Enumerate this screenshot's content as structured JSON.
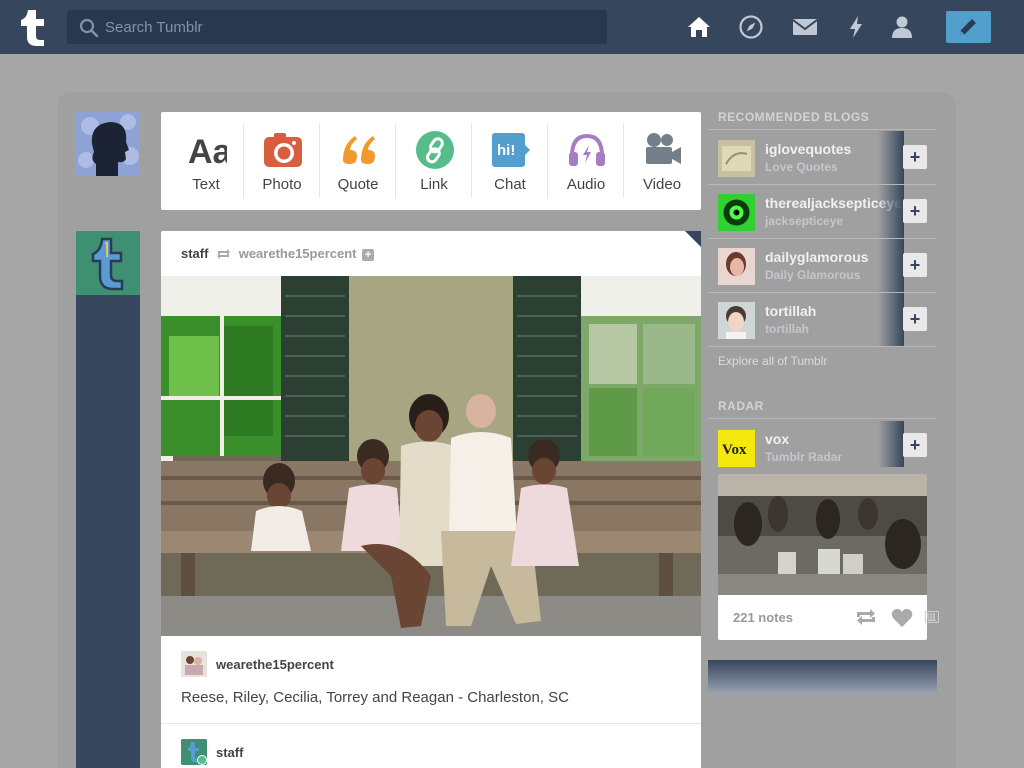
{
  "header": {
    "search_placeholder": "Search Tumblr",
    "nav": [
      "home-icon",
      "explore-compass-icon",
      "inbox-mail-icon",
      "activity-lightning-icon",
      "account-person-icon"
    ],
    "compose": "compose-pencil-icon"
  },
  "composer": {
    "types": [
      {
        "label": "Text",
        "icon": "text-icon",
        "color": "#444444"
      },
      {
        "label": "Photo",
        "icon": "photo-camera-icon",
        "color": "#d95e40"
      },
      {
        "label": "Quote",
        "icon": "quote-icon",
        "color": "#f2992e"
      },
      {
        "label": "Link",
        "icon": "link-icon",
        "color": "#56bc8a"
      },
      {
        "label": "Chat",
        "icon": "chat-bubble-icon",
        "color": "#529ecc"
      },
      {
        "label": "Audio",
        "icon": "audio-headphones-icon",
        "color": "#a77dc2"
      },
      {
        "label": "Video",
        "icon": "video-camera-icon",
        "color": "#748089"
      }
    ]
  },
  "post": {
    "author": "staff",
    "reblogged_from": "wearethe15percent",
    "source_name": "wearethe15percent",
    "caption": "Reese, Riley, Cecilia, Torrey and Reagan - Charleston, SC",
    "next_author": "staff"
  },
  "sidebar": {
    "recommended_title": "RECOMMENDED BLOGS",
    "blogs": [
      {
        "name": "iglovequotes",
        "title": "Love Quotes"
      },
      {
        "name": "therealjacksepticeye",
        "title": "jacksepticeye"
      },
      {
        "name": "dailyglamorous",
        "title": "Daily Glamorous"
      },
      {
        "name": "tortillah",
        "title": "tortillah"
      }
    ],
    "explore_label": "Explore all of Tumblr",
    "radar_title": "RADAR",
    "radar": {
      "name": "vox",
      "subtitle": "Tumblr Radar",
      "logo_text": "Vox",
      "notes": "221 notes"
    }
  },
  "colors": {
    "nav_bg": "#36465d",
    "accent": "#529ecc",
    "page_bg": "#a6a6a6"
  }
}
